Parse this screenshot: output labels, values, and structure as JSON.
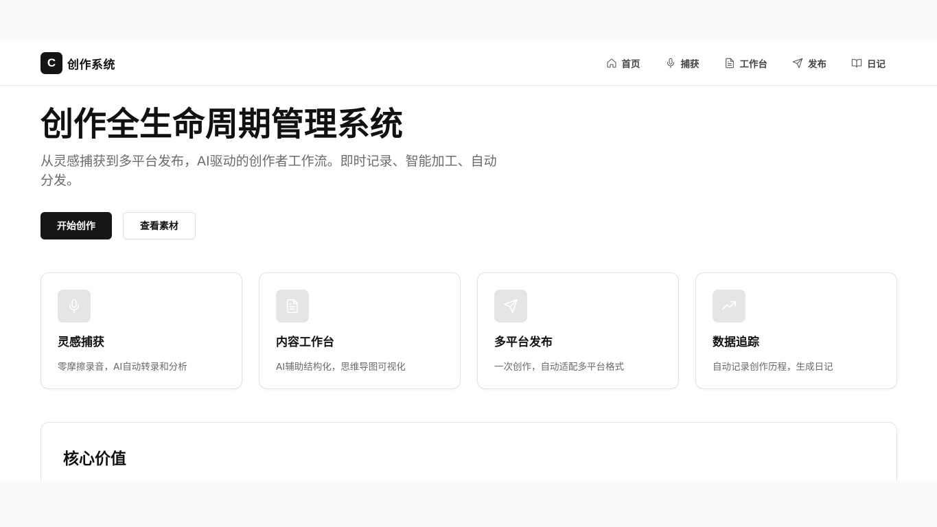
{
  "header": {
    "logo_letter": "C",
    "app_name": "创作系统",
    "nav": [
      {
        "label": "首页",
        "icon": "home-icon"
      },
      {
        "label": "捕获",
        "icon": "mic-icon"
      },
      {
        "label": "工作台",
        "icon": "file-text-icon"
      },
      {
        "label": "发布",
        "icon": "send-icon"
      },
      {
        "label": "日记",
        "icon": "book-open-icon"
      }
    ]
  },
  "hero": {
    "title": "创作全生命周期管理系统",
    "subtitle": "从灵感捕获到多平台发布，AI驱动的创作者工作流。即时记录、智能加工、自动分发。",
    "primary_button": "开始创作",
    "secondary_button": "查看素材"
  },
  "features": [
    {
      "title": "灵感捕获",
      "desc": "零摩擦录音，AI自动转录和分析",
      "icon": "mic-icon"
    },
    {
      "title": "内容工作台",
      "desc": "AI辅助结构化，思维导图可视化",
      "icon": "file-text-icon"
    },
    {
      "title": "多平台发布",
      "desc": "一次创作，自动适配多平台格式",
      "icon": "send-icon"
    },
    {
      "title": "数据追踪",
      "desc": "自动记录创作历程，生成日记",
      "icon": "trending-up-icon"
    }
  ],
  "core_section": {
    "title": "核心价值"
  },
  "colors": {
    "primary": "#161616",
    "text_muted": "#6b6b6b",
    "icon_bg": "#e5e5e5",
    "border": "#e3e3e3"
  }
}
